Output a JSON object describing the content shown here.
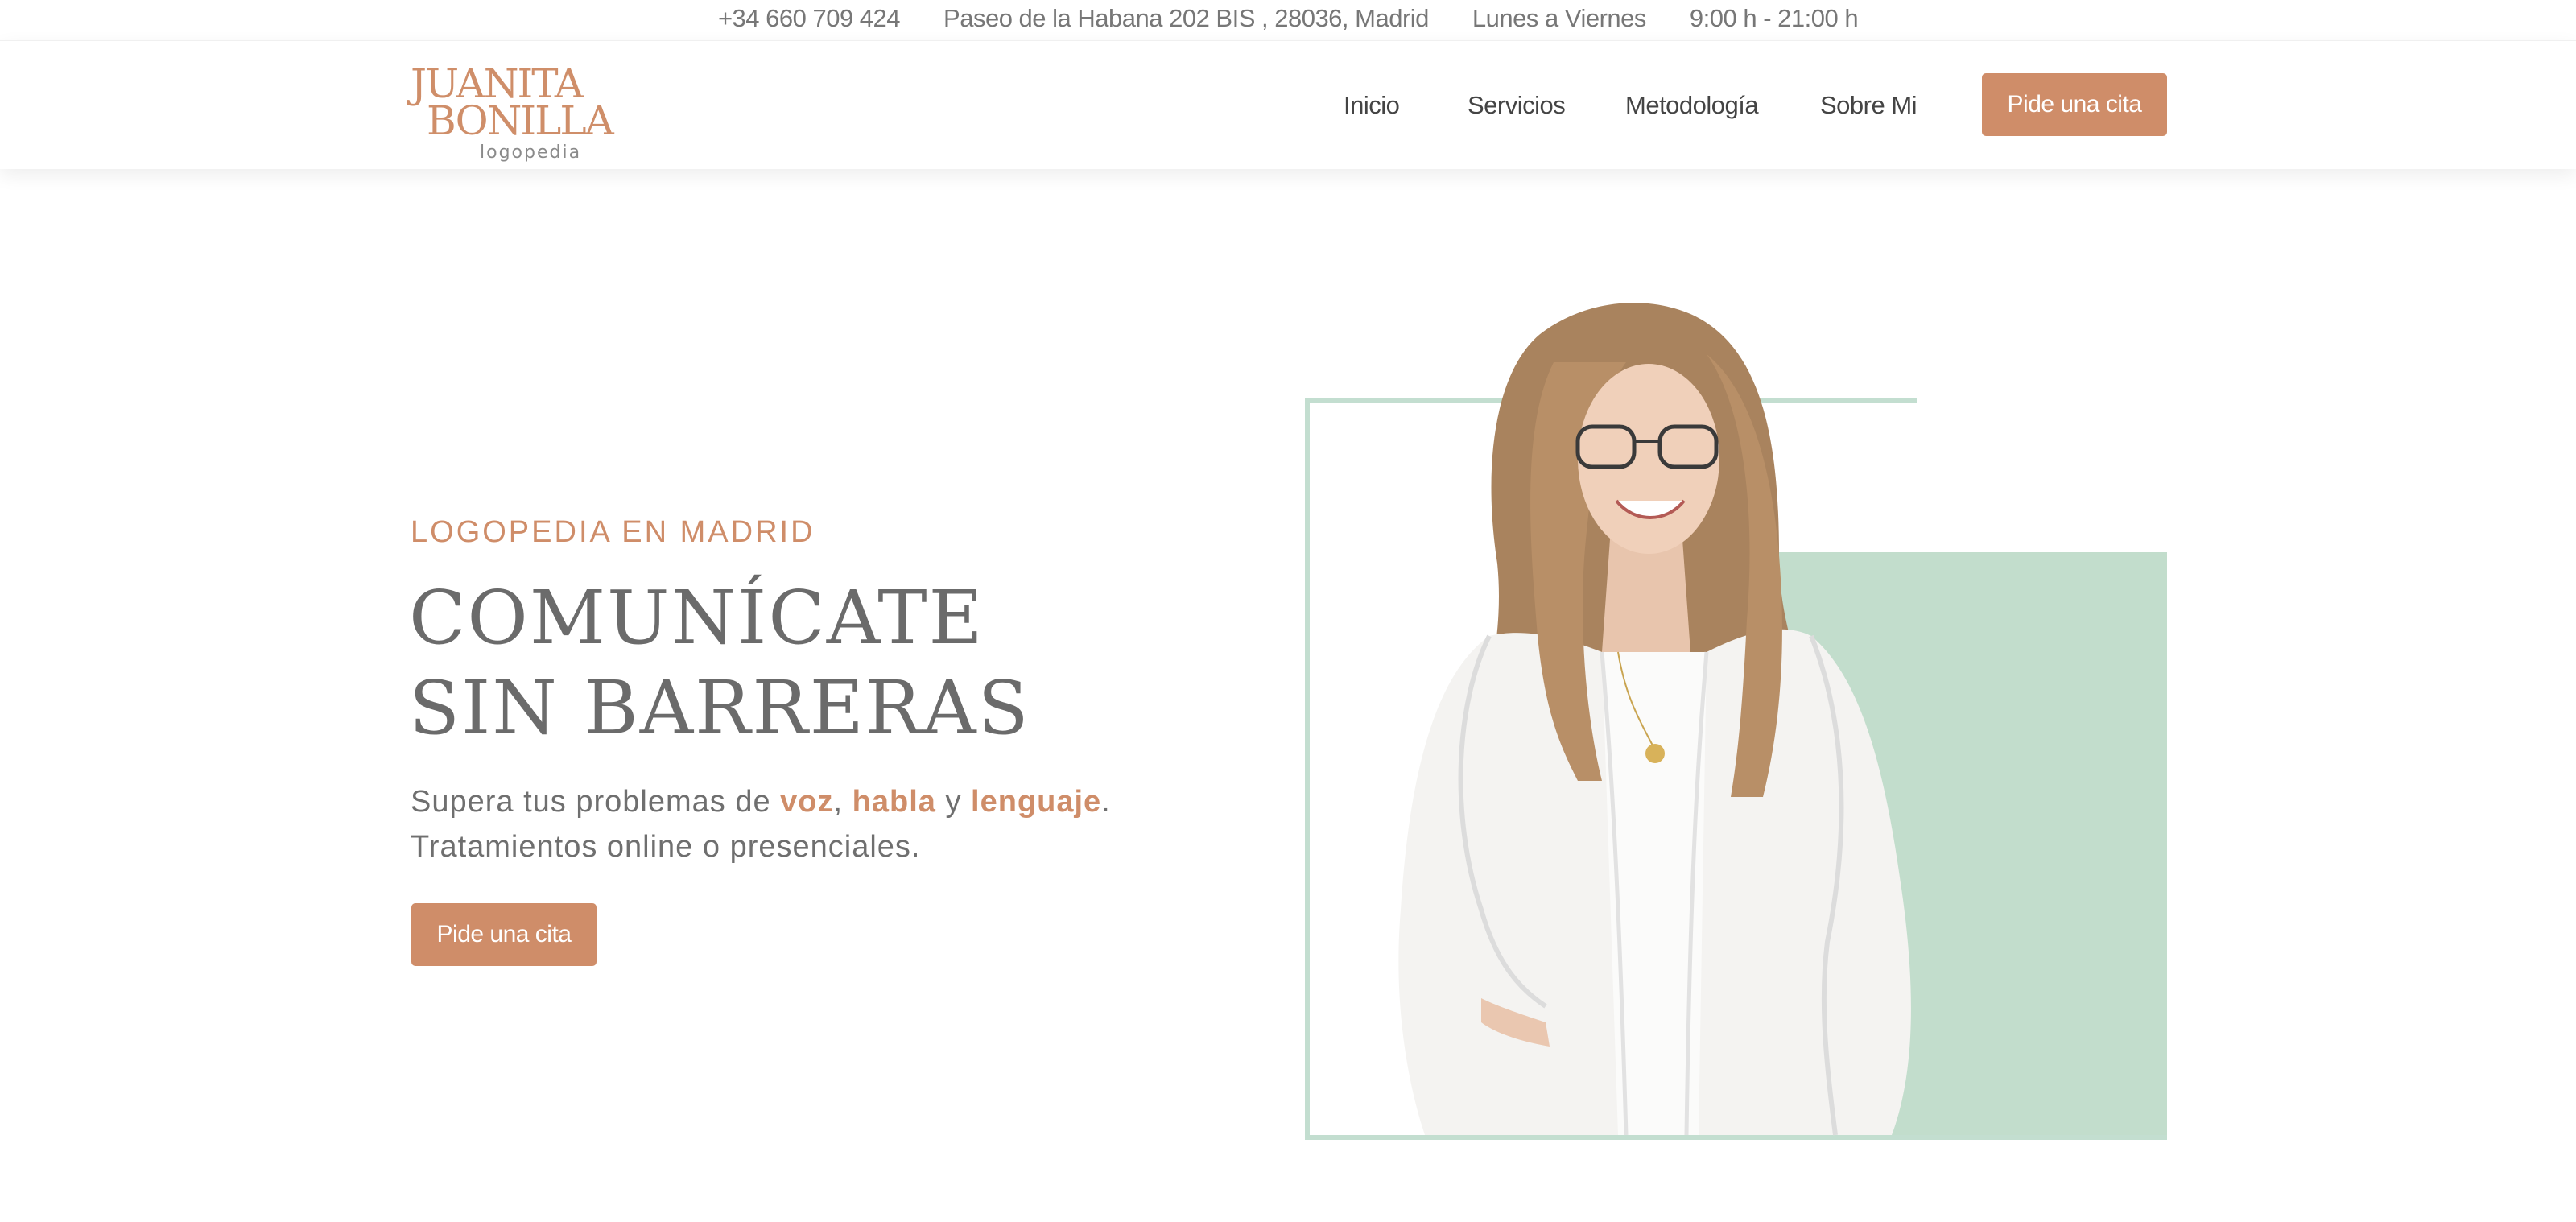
{
  "topbar": {
    "phone": "+34 660 709 424",
    "address": "Paseo de la Habana 202 BIS , 28036, Madrid",
    "days": "Lunes a Viernes",
    "hours": "9:00 h - 21:00 h"
  },
  "logo": {
    "line1": "JUANITA",
    "line2": "BONILLA",
    "line3": "logopedia"
  },
  "nav": {
    "items": [
      {
        "label": "Inicio"
      },
      {
        "label": "Servicios"
      },
      {
        "label": "Metodología"
      },
      {
        "label": "Sobre Mi"
      }
    ],
    "cta": "Pide una cita"
  },
  "hero": {
    "kicker": "LOGOPEDIA EN MADRID",
    "title_line1": "COMUNÍCATE",
    "title_line2": "SIN BARRERAS",
    "subtitle": {
      "prefix": "Supera tus problemas de ",
      "word1": "voz",
      "sep1": ", ",
      "word2": "habla",
      "sep2": " y ",
      "word3": "lenguaje",
      "suffix": ".",
      "line2": "Tratamientos online o presenciales."
    },
    "cta": "Pide una cita"
  },
  "colors": {
    "accent": "#cf8d69",
    "green": "#c2ddcc",
    "text": "#6b6b6b"
  }
}
